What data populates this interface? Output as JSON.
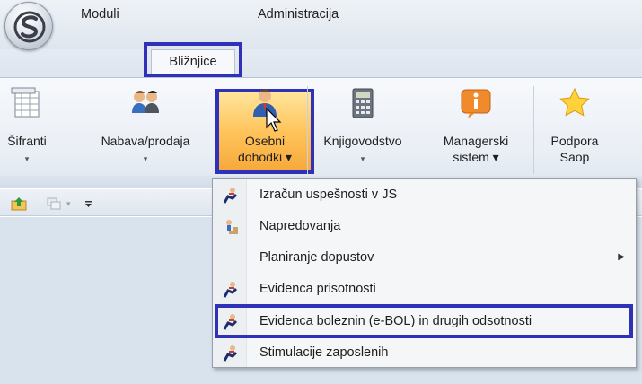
{
  "tabs": {
    "moduli": "Moduli",
    "bliznjice": "Bližnjice",
    "administracija": "Administracija"
  },
  "ribbon": {
    "sifranti": {
      "line1": "Šifranti",
      "caret": "▾"
    },
    "nabava": {
      "line1": "Nabava/prodaja",
      "caret": "▾"
    },
    "osebni": {
      "line1": "Osebni",
      "line2": "dohodki ▾"
    },
    "knjigovodstvo": {
      "line1": "Knjigovodstvo",
      "caret": "▾"
    },
    "managerski": {
      "line1": "Managerski",
      "line2": "sistem ▾"
    },
    "podpora": {
      "line1": "Podpora",
      "line2": "Saop"
    }
  },
  "quick_access": {
    "dropdown": "▾"
  },
  "menu": {
    "items": [
      {
        "label": "Izračun uspešnosti v JS",
        "icon": "running-person-icon"
      },
      {
        "label": "Napredovanja",
        "icon": "stairs-person-icon"
      },
      {
        "label": "Planiranje dopustov",
        "icon": "",
        "submenu": "▶"
      },
      {
        "label": "Evidenca prisotnosti",
        "icon": "running-person-icon"
      },
      {
        "label": "Evidenca boleznin (e-BOL)  in drugih odsotnosti",
        "icon": "running-person-icon"
      },
      {
        "label": "Stimulacije zaposlenih",
        "icon": "running-person-icon"
      }
    ]
  },
  "colors": {
    "highlight_border": "#2f32b8",
    "active_button": "#ffc45c"
  }
}
